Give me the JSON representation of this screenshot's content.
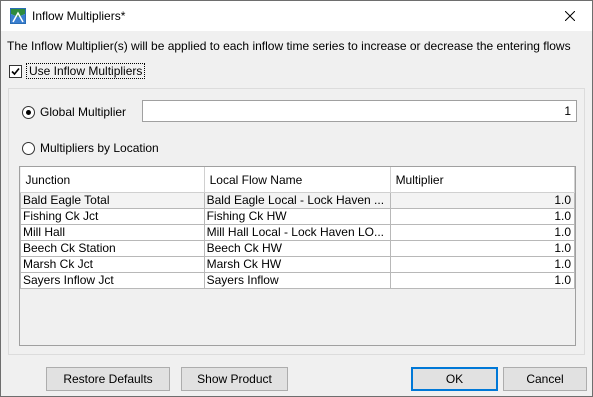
{
  "window": {
    "title": "Inflow Multipliers*"
  },
  "description": "The Inflow Multiplier(s) will be applied to each inflow time series to increase or decrease the entering flows",
  "use_inflow_multipliers": {
    "label": "Use Inflow Multipliers",
    "checked": true
  },
  "global": {
    "label": "Global Multiplier",
    "selected": true,
    "value": "1"
  },
  "by_location": {
    "label": "Multipliers by Location",
    "selected": false
  },
  "table": {
    "headers": [
      "Junction",
      "Local Flow Name",
      "Multiplier"
    ],
    "rows": [
      {
        "junction": "Bald Eagle Total",
        "local_flow_name": "Bald Eagle Local - Lock Haven ...",
        "multiplier": "1.0"
      },
      {
        "junction": "Fishing Ck Jct",
        "local_flow_name": "Fishing Ck HW",
        "multiplier": "1.0"
      },
      {
        "junction": "Mill Hall",
        "local_flow_name": "Mill Hall Local - Lock Haven LO...",
        "multiplier": "1.0"
      },
      {
        "junction": "Beech Ck Station",
        "local_flow_name": "Beech Ck HW",
        "multiplier": "1.0"
      },
      {
        "junction": "Marsh Ck Jct",
        "local_flow_name": "Marsh Ck HW",
        "multiplier": "1.0"
      },
      {
        "junction": "Sayers Inflow Jct",
        "local_flow_name": "Sayers Inflow",
        "multiplier": "1.0"
      }
    ]
  },
  "buttons": {
    "restore_defaults": "Restore Defaults",
    "show_product": "Show Product",
    "ok": "OK",
    "cancel": "Cancel"
  },
  "icons": {
    "app": "app-icon",
    "close": "close-icon",
    "checkmark": "checkmark-icon"
  }
}
